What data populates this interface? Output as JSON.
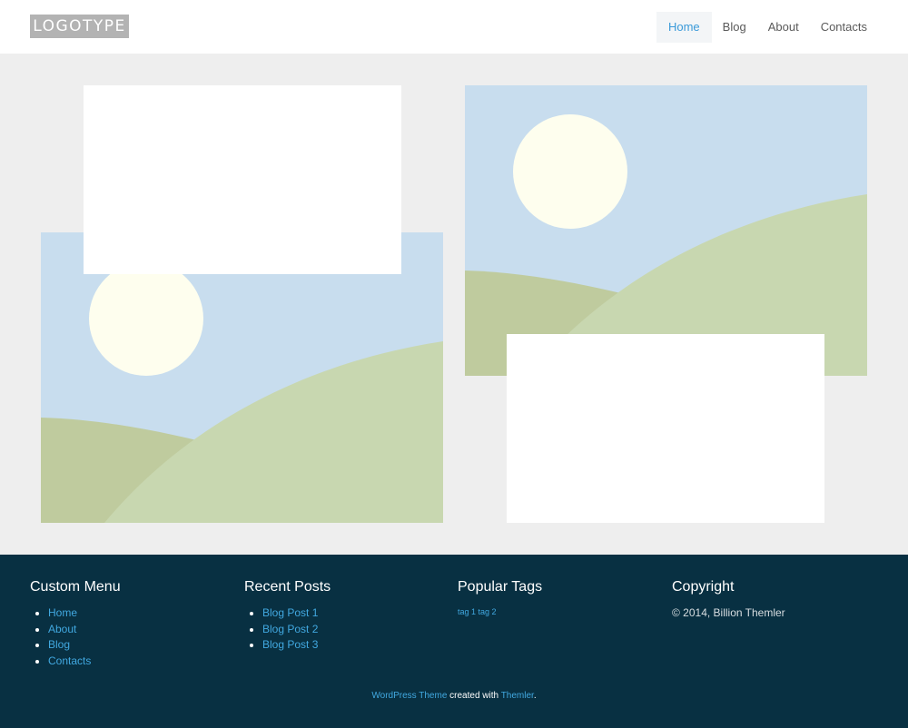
{
  "header": {
    "logo_text": "LOGOTYPE",
    "nav": [
      {
        "label": "Home",
        "active": true
      },
      {
        "label": "Blog",
        "active": false
      },
      {
        "label": "About",
        "active": false
      },
      {
        "label": "Contacts",
        "active": false
      }
    ]
  },
  "colors": {
    "page_bg": "#eeeeee",
    "footer_bg": "#083042",
    "link": "#41a8e0",
    "nav_active": "#3a9ad9",
    "sky": "#c8ddee",
    "sun": "#fefeee",
    "hill_back": "#bfcb9e",
    "hill_front": "#c8d7b0"
  },
  "footer": {
    "custom_menu": {
      "title": "Custom Menu",
      "items": [
        "Home",
        "About",
        "Blog",
        "Contacts"
      ]
    },
    "recent_posts": {
      "title": "Recent Posts",
      "items": [
        "Blog Post 1",
        "Blog Post 2",
        "Blog Post 3"
      ]
    },
    "popular_tags": {
      "title": "Popular Tags",
      "tags": [
        "tag 1",
        "tag 2"
      ]
    },
    "copyright": {
      "title": "Copyright",
      "text": "© 2014, Billion Themler"
    },
    "credit": {
      "link1": "WordPress Theme",
      "middle": " created with ",
      "link2": "Themler",
      "end": "."
    }
  }
}
